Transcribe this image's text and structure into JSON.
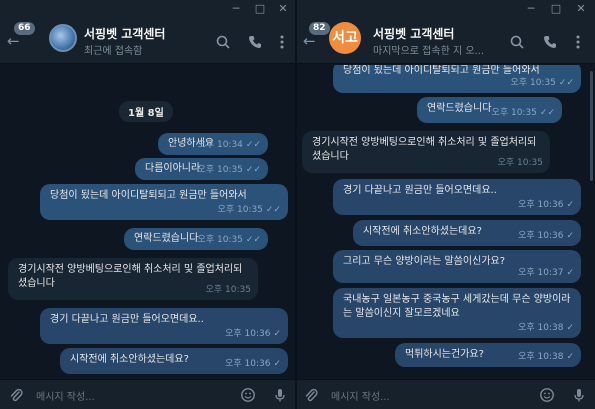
{
  "colors": {
    "background": "#0e1621",
    "header": "#17212b",
    "incoming_bubble": "#182533",
    "outgoing_bubble": "#2b5278",
    "avatar_orange": "#ef8d3e",
    "accent_check": "#7fa9d8"
  },
  "left": {
    "header": {
      "unread_badge": "66",
      "title": "서핑벳 고객센터",
      "status": "최근에 접속함"
    },
    "date_separator": "1월 8일",
    "messages": [
      {
        "text": "안녕하세요",
        "time": "오후 10:34",
        "dir": "out",
        "read": true
      },
      {
        "text": "다름이아니라",
        "time": "오후 10:35",
        "dir": "out",
        "read": true
      },
      {
        "text": "당첨이 됬는데 아이디탈퇴되고 원금만 들어와서",
        "time": "오후 10:35",
        "dir": "out",
        "read": true
      },
      {
        "text": "연락드렸습니다",
        "time": "오후 10:35",
        "dir": "out",
        "read": true
      },
      {
        "text": "경기시작전 양방베팅으로인해 취소처리 및 졸업처리되셨습니다",
        "time": "오후 10:35",
        "dir": "in"
      },
      {
        "text": "경기 다끝나고 원금만 들어오면데요..",
        "time": "오후 10:36",
        "dir": "out",
        "read": false
      },
      {
        "text": "시작전에 취소안하셨는데요?",
        "time": "오후 10:36",
        "dir": "out",
        "read": false
      }
    ],
    "composer": {
      "placeholder": "메시지 작성..."
    }
  },
  "right": {
    "header": {
      "unread_badge": "82",
      "avatar_text": "서고",
      "title": "서핑벳 고객센터",
      "status": "마지막으로 접속한 지 오..."
    },
    "messages": [
      {
        "text": "당첨이 됬는데 아이디탈퇴되고 원금만 들어와서",
        "time": "오후 10:35",
        "dir": "out",
        "read": true
      },
      {
        "text": "연락드렸습니다",
        "time": "오후 10:35",
        "dir": "out",
        "read": true
      },
      {
        "text": "경기시작전 양방베팅으로인해 취소처리 및 졸업처리되셨습니다",
        "time": "오후 10:35",
        "dir": "in"
      },
      {
        "text": "경기 다끝나고 원금만 들어오면데요..",
        "time": "오후 10:36",
        "dir": "out",
        "read": false
      },
      {
        "text": "시작전에 취소안하셨는데요?",
        "time": "오후 10:36",
        "dir": "out",
        "read": false
      },
      {
        "text": "그리고 무슨 양방이라는 말씀이신가요?",
        "time": "오후 10:37",
        "dir": "out",
        "read": false
      },
      {
        "text": "국내농구 일본농구 중국농구 세게갔는데 무슨 양방이라는 말씀이신지 잘모르겠네요",
        "time": "오후 10:38",
        "dir": "out",
        "read": false
      },
      {
        "text": "먹튀하시는건가요?",
        "time": "오후 10:38",
        "dir": "out",
        "read": false
      }
    ],
    "composer": {
      "placeholder": "메시지 작성..."
    }
  },
  "icons": {
    "back": "arrow-left-icon",
    "search": "search-icon",
    "phone": "phone-icon",
    "more": "more-vertical-icon",
    "attach": "paperclip-icon",
    "emoji": "emoji-icon",
    "mic": "microphone-icon"
  }
}
